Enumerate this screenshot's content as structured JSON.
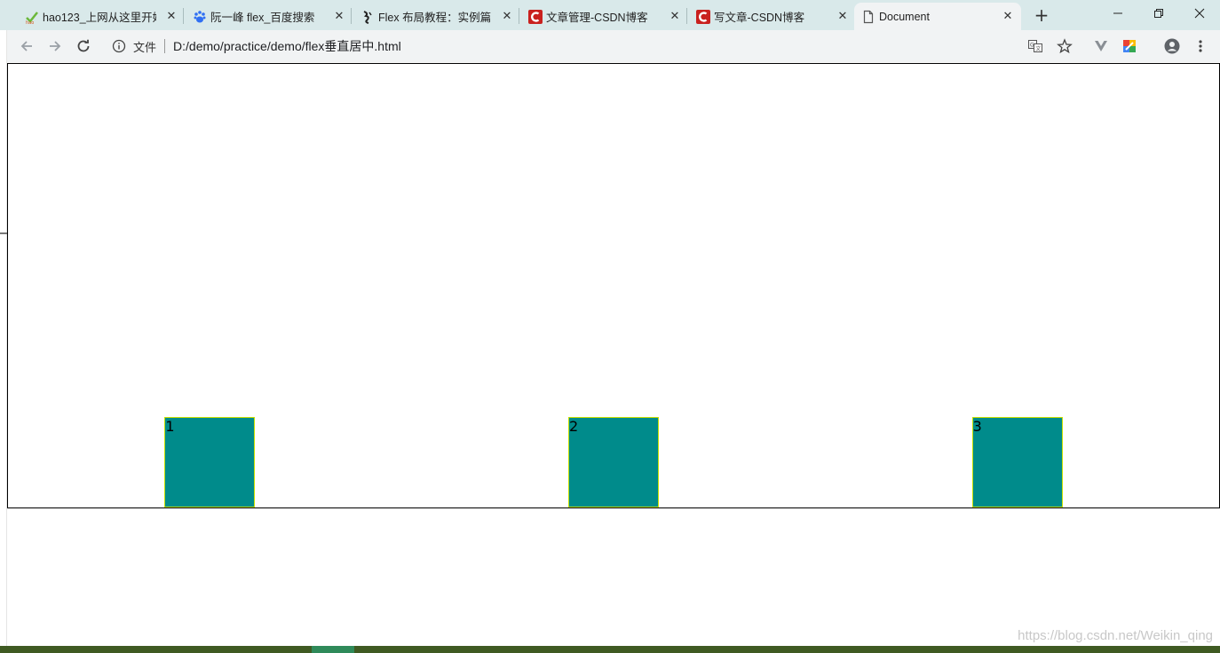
{
  "browser": {
    "tabs": [
      {
        "title": "hao123_上网从这里开始",
        "icon": "hao123-favicon-icon",
        "active": false
      },
      {
        "title": "阮一峰 flex_百度搜索",
        "icon": "baidu-paw-icon",
        "active": false
      },
      {
        "title": "Flex 布局教程：实例篇",
        "icon": "calligraphy-favicon-icon",
        "active": false
      },
      {
        "title": "文章管理-CSDN博客",
        "icon": "csdn-icon",
        "active": false
      },
      {
        "title": "写文章-CSDN博客",
        "icon": "csdn-icon",
        "active": false
      },
      {
        "title": "Document",
        "icon": "file-icon",
        "active": true
      }
    ],
    "close_glyph": "✕",
    "new_tab_glyph": "+",
    "address": {
      "scheme_label": "文件",
      "url": "D:/demo/practice/demo/flex垂直居中.html"
    }
  },
  "page": {
    "items": [
      {
        "label": "1"
      },
      {
        "label": "2"
      },
      {
        "label": "3"
      }
    ]
  },
  "watermark": "https://blog.csdn.net/Weikin_qing",
  "colors": {
    "item_fill": "#008b8b",
    "item_border": "#c8e000",
    "container_border": "#000000",
    "tabstrip_bg": "#d9e9ea",
    "csdn_red": "#c9211e"
  }
}
